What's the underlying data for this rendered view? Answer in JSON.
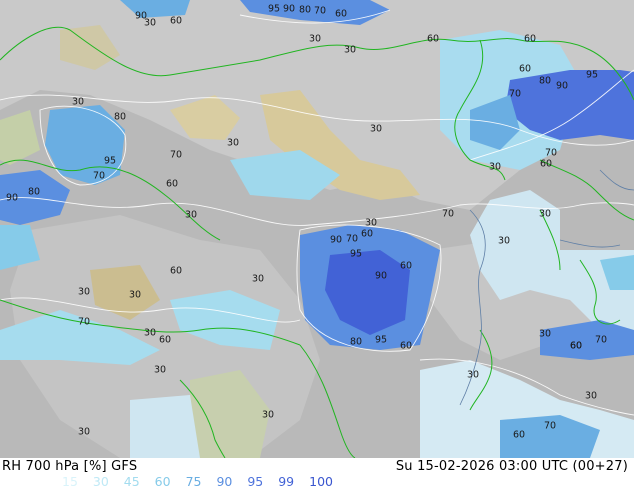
{
  "footer": {
    "product": "RH 700 hPa [%] GFS",
    "valid_time": "Su 15-02-2026 03:00 UTC (00+27)"
  },
  "legend": {
    "levels": [
      "15",
      "30",
      "45",
      "60",
      "75",
      "90",
      "95",
      "99",
      "100"
    ],
    "colors": [
      "#d9f3fa",
      "#bfe9f6",
      "#a3dcef",
      "#86cbe9",
      "#6aaee2",
      "#5b8fe0",
      "#4e73dc",
      "#4262d6",
      "#3a56cf"
    ]
  },
  "map_labels": [
    {
      "text": "90"
    },
    {
      "text": "30"
    },
    {
      "text": "60"
    },
    {
      "text": "95"
    },
    {
      "text": "90"
    },
    {
      "text": "80"
    },
    {
      "text": "70"
    },
    {
      "text": "60"
    },
    {
      "text": "30"
    },
    {
      "text": "60"
    },
    {
      "text": "60"
    },
    {
      "text": "30"
    },
    {
      "text": "60"
    },
    {
      "text": "95"
    },
    {
      "text": "80"
    },
    {
      "text": "90"
    },
    {
      "text": "70"
    },
    {
      "text": "30"
    },
    {
      "text": "30"
    },
    {
      "text": "80"
    },
    {
      "text": "30"
    },
    {
      "text": "70"
    },
    {
      "text": "95"
    },
    {
      "text": "70"
    },
    {
      "text": "60"
    },
    {
      "text": "80"
    },
    {
      "text": "90"
    },
    {
      "text": "30"
    },
    {
      "text": "60"
    },
    {
      "text": "70"
    },
    {
      "text": "30"
    },
    {
      "text": "70"
    },
    {
      "text": "30"
    },
    {
      "text": "30"
    },
    {
      "text": "90"
    },
    {
      "text": "70"
    },
    {
      "text": "60"
    },
    {
      "text": "95"
    },
    {
      "text": "60"
    },
    {
      "text": "90"
    },
    {
      "text": "60"
    },
    {
      "text": "30"
    },
    {
      "text": "30"
    },
    {
      "text": "30"
    },
    {
      "text": "70"
    },
    {
      "text": "30"
    },
    {
      "text": "60"
    },
    {
      "text": "80"
    },
    {
      "text": "95"
    },
    {
      "text": "60"
    },
    {
      "text": "30"
    },
    {
      "text": "60"
    },
    {
      "text": "30"
    },
    {
      "text": "60"
    },
    {
      "text": "70"
    },
    {
      "text": "30"
    },
    {
      "text": "30"
    },
    {
      "text": "30"
    },
    {
      "text": "30"
    },
    {
      "text": "70"
    },
    {
      "text": "60"
    },
    {
      "text": "30"
    }
  ]
}
